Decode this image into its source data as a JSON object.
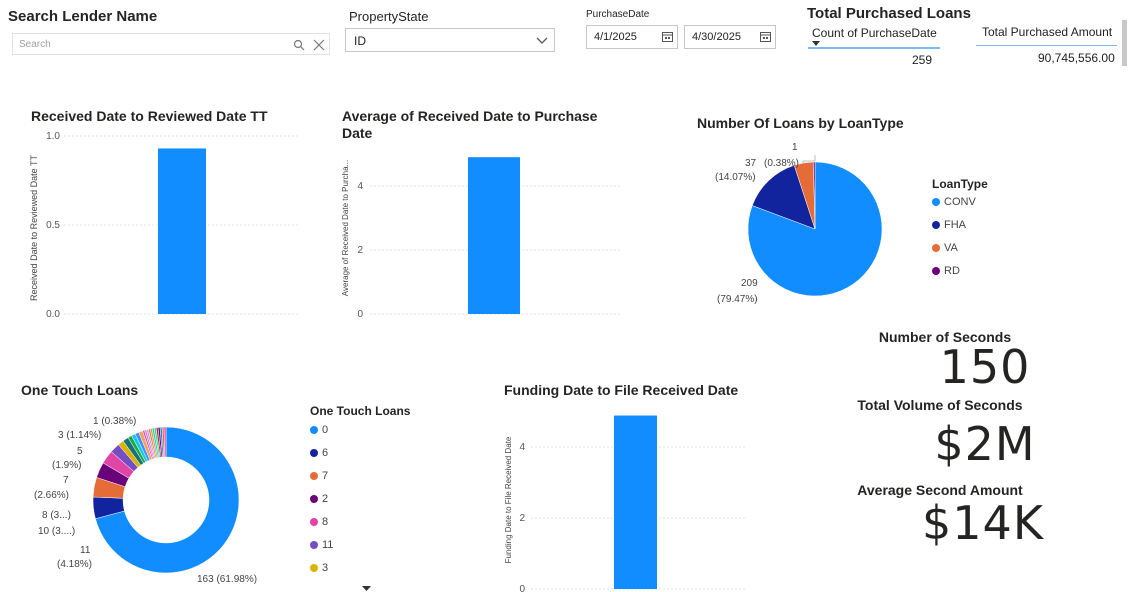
{
  "search": {
    "title": "Search Lender Name",
    "placeholder": "Search"
  },
  "property_state": {
    "title": "PropertyState",
    "value": "ID"
  },
  "purchase_date": {
    "title": "PurchaseDate",
    "start": "4/1/2025",
    "end": "4/30/2025"
  },
  "total_purchased": {
    "title": "Total Purchased Loans",
    "count_label": "Count of PurchaseDate",
    "count_value": "259",
    "amount_label": "Total Purchased Amount",
    "amount_value": "90,745,556.00"
  },
  "kpis": {
    "seconds_label": "Number of Seconds",
    "seconds_value": "150",
    "volume_label": "Total Volume of Seconds",
    "volume_value": "$2M",
    "avg_label": "Average Second Amount",
    "avg_value": "$14K"
  },
  "colors": {
    "blue": "#118DFF",
    "navy": "#12239E",
    "orange": "#E66C37",
    "purple": "#6B007B",
    "pink": "#E044A7",
    "violet": "#744EC2",
    "yellow": "#D9B300"
  },
  "chart_data": [
    {
      "type": "bar",
      "title": "Received Date to Reviewed Date TT",
      "ylabel": "Received Date to Reviewed Date TT",
      "categories": [
        ""
      ],
      "values": [
        0.93
      ],
      "ylim": [
        0,
        1.0
      ],
      "ticks": [
        "0.0",
        "0.5",
        "1.0"
      ]
    },
    {
      "type": "bar",
      "title": "Average of Received Date to Purchase Date",
      "ylabel": "Average of Received Date to Purcha...",
      "categories": [
        ""
      ],
      "values": [
        4.9
      ],
      "ylim": [
        0,
        5
      ],
      "ticks": [
        "0",
        "2",
        "4"
      ]
    },
    {
      "type": "pie",
      "title": "Number Of Loans by LoanType",
      "legend_title": "LoanType",
      "labels": [
        "CONV",
        "FHA",
        "VA",
        "RD"
      ],
      "values": [
        209,
        37,
        12,
        1
      ],
      "data_labels": [
        "209",
        "37",
        "",
        "1"
      ],
      "pct_labels": [
        "(79.47%)",
        "(14.07%)",
        "",
        "(0.38%)"
      ]
    },
    {
      "type": "pie",
      "title": "One Touch Loans",
      "legend_title": "One Touch Loans",
      "legend": [
        "0",
        "6",
        "7",
        "2",
        "8",
        "11",
        "3"
      ],
      "data_labels": [
        "163 (61.98%)",
        "11",
        "(4.18%)",
        "10 (3....)",
        "8 (3...)",
        "7",
        "(2.66%)",
        "5",
        "(1.9%)",
        "3 (1.14%)",
        "1 (0.38%)"
      ]
    },
    {
      "type": "bar",
      "title": "Funding Date to File Received Date",
      "ylabel": "Funding Date to File Received Date",
      "categories": [
        ""
      ],
      "values": [
        4.9
      ],
      "ylim": [
        0,
        5
      ],
      "ticks": [
        "0",
        "2",
        "4"
      ]
    }
  ]
}
